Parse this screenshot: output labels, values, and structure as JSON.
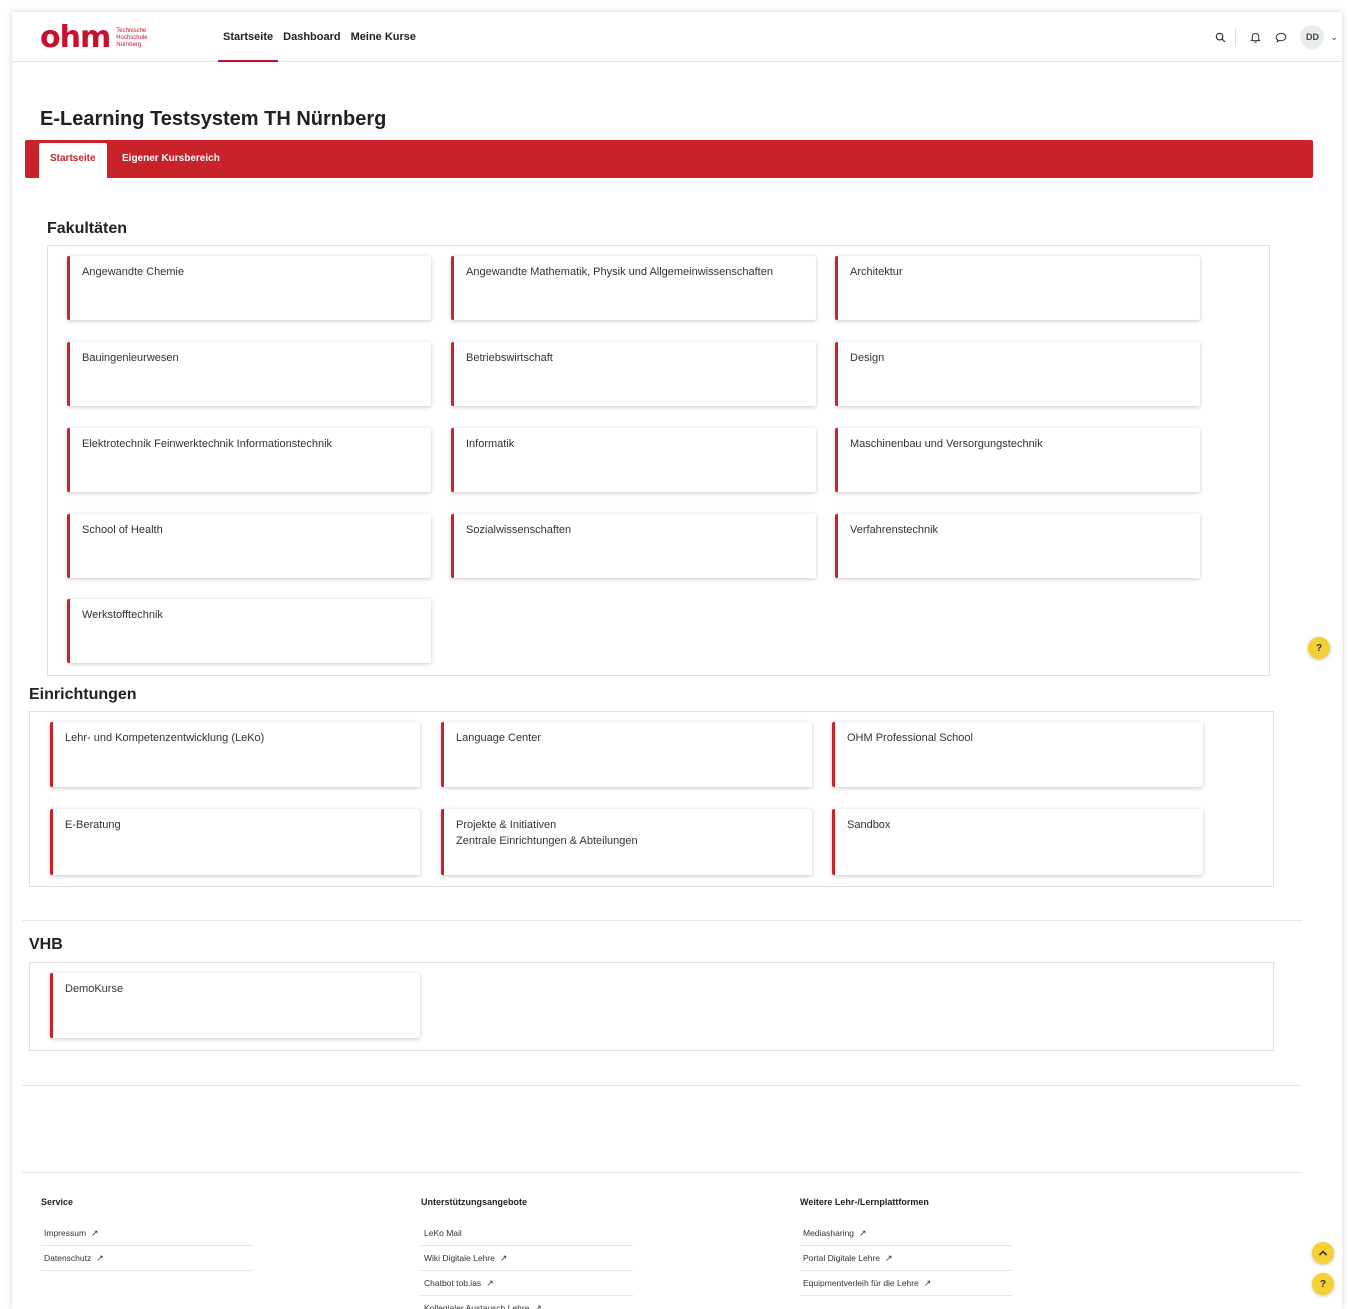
{
  "brand": {
    "logo_word": "ohm",
    "logo_sub": [
      "Technische",
      "Hochschule",
      "Nürnberg"
    ],
    "color": "#c8102e"
  },
  "nav": {
    "links": [
      {
        "label": "Startseite",
        "active": true
      },
      {
        "label": "Dashboard"
      },
      {
        "label": "Meine Kurse"
      }
    ],
    "search_icon": "search-icon",
    "bell_icon": "bell-icon",
    "chat_icon": "chat-icon",
    "avatar_initials": "DD"
  },
  "page": {
    "title": "E-Learning Testsystem TH Nürnberg",
    "tabs": [
      {
        "label": "Startseite",
        "active": true
      },
      {
        "label": "Eigener Kursbereich"
      }
    ]
  },
  "sections": {
    "fakultaeten": {
      "title": "Fakultäten",
      "items": [
        "Angewandte Chemie",
        "Angewandte Mathematik, Physik und Allgemeinwissenschaften",
        "Architektur",
        "Bauingenieurwesen",
        "Betriebswirtschaft",
        "Design",
        "Elektrotechnik Feinwerktechnik Informationstechnik",
        "Informatik",
        "Maschinenbau und Versorgungstechnik",
        "School of Health",
        "Sozialwissenschaften",
        "Verfahrenstechnik",
        "Werkstofftechnik"
      ]
    },
    "einrichtungen": {
      "title": "Einrichtungen",
      "items": [
        {
          "line1": "Lehr- und Kompetenzentwicklung (LeKo)"
        },
        {
          "line1": "Language Center"
        },
        {
          "line1": "OHM Professional School"
        },
        {
          "line1": "E-Beratung"
        },
        {
          "line1": "Projekte & Initiativen",
          "line2": "Zentrale Einrichtungen & Abteilungen"
        },
        {
          "line1": "Sandbox"
        }
      ]
    },
    "vhb": {
      "title": "VHB",
      "items": [
        "DemoKurse"
      ]
    }
  },
  "help": {
    "label": "?"
  },
  "scroll_top": {
    "label": "^"
  },
  "footer": {
    "service": {
      "heading": "Service",
      "links": [
        "Impressum",
        "Datenschutz"
      ]
    },
    "support": {
      "heading": "Unterstützungsangebote",
      "links": [
        "LeKo Mail",
        "Wiki Digitale Lehre",
        "Chatbot tob.ias",
        "Kollegialer Austausch Lehre"
      ],
      "external": [
        false,
        true,
        true,
        true
      ]
    },
    "platforms": {
      "heading": "Weitere Lehr-/Lernplattformen",
      "links": [
        "Mediasharing",
        "Portal Digitale Lehre",
        "Equipmentverleih für die Lehre"
      ]
    }
  }
}
